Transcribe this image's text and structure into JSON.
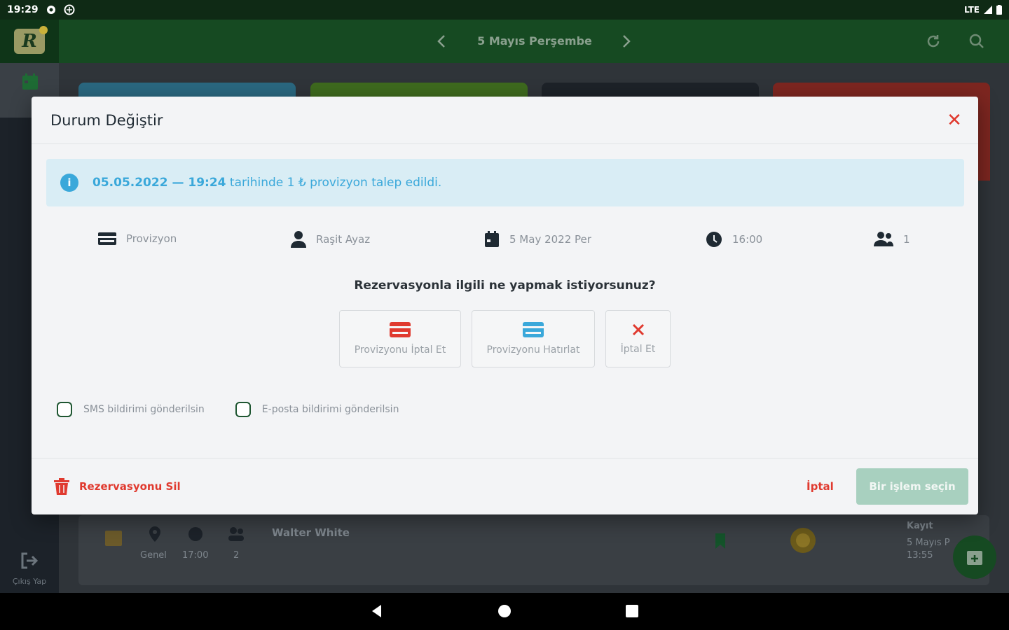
{
  "status_bar": {
    "time": "19:29",
    "network": "LTE"
  },
  "app_bar": {
    "logo_letter": "R",
    "date_title": "5 Mayıs Perşembe"
  },
  "sidebar": {
    "logout_label": "Çıkış Yap"
  },
  "background_row": {
    "place": "Genel",
    "time": "17:00",
    "guests": "2",
    "name": "Walter White",
    "record_label": "Kayıt",
    "record_date": "5 Mayıs P",
    "record_time": "13:55"
  },
  "dialog": {
    "title": "Durum Değiştir",
    "close_icon": "close-icon",
    "alert": {
      "datetime": "05.05.2022 — 19:24",
      "message": "tarihinde 1 ₺ provizyon talep edildi."
    },
    "info": {
      "type": "Provizyon",
      "person": "Raşit Ayaz",
      "date": "5 May 2022 Per",
      "time": "16:00",
      "guests": "1"
    },
    "question": "Rezervasyonla ilgili ne yapmak istiyorsunuz?",
    "actions": [
      {
        "label": "Provizyonu İptal Et",
        "icon": "credit-card-icon",
        "color": "#e03a2f"
      },
      {
        "label": "Provizyonu Hatırlat",
        "icon": "credit-card-icon",
        "color": "#3aa8da"
      },
      {
        "label": "İptal Et",
        "icon": "close-icon",
        "color": "#e03a2f"
      }
    ],
    "checkboxes": {
      "sms": "SMS bildirimi gönderilsin",
      "email": "E-posta bildirimi gönderilsin"
    },
    "footer": {
      "delete_label": "Rezervasyonu Sil",
      "cancel_label": "İptal",
      "confirm_label": "Bir işlem seçin"
    }
  },
  "colors": {
    "primary": "#164a22",
    "danger": "#e03a2f",
    "info": "#3aa8da",
    "disabled_button": "#a8d0bf"
  }
}
